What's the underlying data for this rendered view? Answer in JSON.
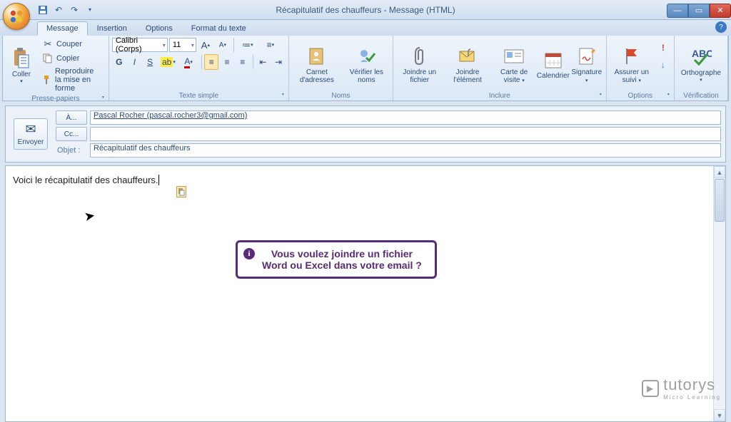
{
  "window": {
    "title": "Récapitulatif des chauffeurs - Message (HTML)"
  },
  "tabs": {
    "message": "Message",
    "insertion": "Insertion",
    "options": "Options",
    "format": "Format du texte"
  },
  "clipboard": {
    "paste": "Coller",
    "cut": "Couper",
    "copy": "Copier",
    "format_painter": "Reproduire la mise en forme",
    "group_label": "Presse-papiers"
  },
  "font": {
    "name": "Calibri (Corps)",
    "size": "11",
    "group_label": "Texte simple"
  },
  "names": {
    "address_book": "Carnet d'adresses",
    "check_names": "Vérifier les noms",
    "group_label": "Noms"
  },
  "include": {
    "attach_file": "Joindre un fichier",
    "attach_item": "Joindre l'élément",
    "business_card": "Carte de visite",
    "calendar": "Calendrier",
    "signature": "Signature",
    "group_label": "Inclure"
  },
  "options": {
    "follow_up": "Assurer un suivi",
    "group_label": "Options"
  },
  "proofing": {
    "spelling": "Orthographe",
    "group_label": "Vérification"
  },
  "header": {
    "send": "Envoyer",
    "to_btn": "À...",
    "cc_btn": "Cc...",
    "subject_lbl": "Objet :",
    "to_value": "Pascal Rocher (pascal.rocher3@gmail.com)",
    "cc_value": "",
    "subject_value": "Récapitulatif des chauffeurs"
  },
  "body": {
    "text": "Voici le récapitulatif des chauffeurs."
  },
  "overlay": {
    "line1": "Vous voulez joindre un fichier",
    "line2": "Word ou Excel dans votre email ?"
  },
  "watermark": {
    "brand": "tutorys",
    "sub": "Micro Learning"
  }
}
